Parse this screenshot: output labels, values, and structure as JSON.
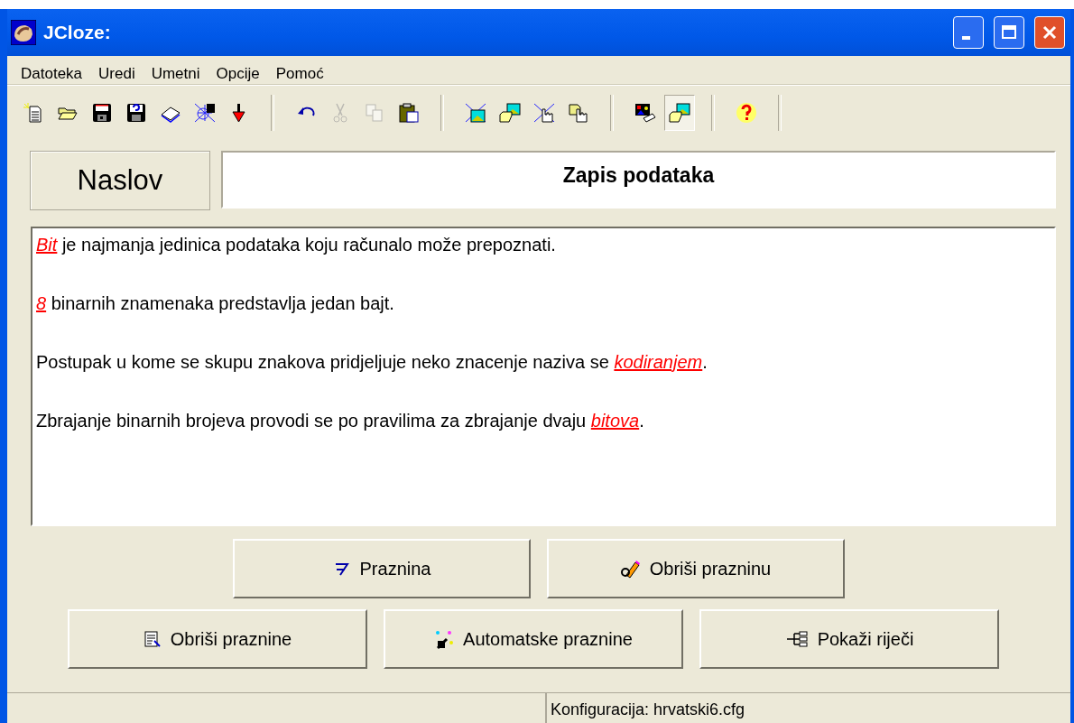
{
  "window": {
    "title": "JCloze:"
  },
  "menu": [
    "Datoteka",
    "Uredi",
    "Umetni",
    "Opcije",
    "Pomoć"
  ],
  "toolbar": [
    {
      "kind": "new",
      "disabled": false,
      "pressed": false
    },
    {
      "kind": "open",
      "disabled": false,
      "pressed": false
    },
    {
      "kind": "save",
      "disabled": false,
      "pressed": false
    },
    {
      "kind": "saveas",
      "disabled": false,
      "pressed": false
    },
    {
      "kind": "book",
      "disabled": false,
      "pressed": false
    },
    {
      "kind": "web6",
      "disabled": false,
      "pressed": false
    },
    {
      "kind": "arrow",
      "disabled": false,
      "pressed": false
    },
    {
      "kind": "separator"
    },
    {
      "kind": "undo",
      "disabled": false,
      "pressed": false
    },
    {
      "kind": "cut",
      "disabled": true,
      "pressed": false
    },
    {
      "kind": "copy",
      "disabled": true,
      "pressed": false
    },
    {
      "kind": "paste",
      "disabled": false,
      "pressed": false
    },
    {
      "kind": "separator"
    },
    {
      "kind": "webpic",
      "disabled": false,
      "pressed": false
    },
    {
      "kind": "folderpic",
      "disabled": false,
      "pressed": false
    },
    {
      "kind": "webhand",
      "disabled": false,
      "pressed": false
    },
    {
      "kind": "folderhand",
      "disabled": false,
      "pressed": false
    },
    {
      "kind": "separator"
    },
    {
      "kind": "pictag",
      "disabled": false,
      "pressed": false
    },
    {
      "kind": "folderpic",
      "disabled": false,
      "pressed": true
    },
    {
      "kind": "separator"
    },
    {
      "kind": "help",
      "disabled": false,
      "pressed": false
    },
    {
      "kind": "separator"
    }
  ],
  "title_row": {
    "label": "Naslov",
    "value": "Zapis podataka"
  },
  "text": [
    "*Bit* je najmanja  jedinica podataka koju računalo može prepoznati.",
    "*8* binarnih znamenaka predstavlja jedan bajt.",
    "Postupak u kome se skupu znakova pridjeljuje neko znacenje naziva se *kodiranjem*.",
    "Zbrajanje binarnih brojeva provodi se po pravilima za zbrajanje dvaju *bitova*."
  ],
  "button_rows": [
    [
      {
        "label": "Praznina",
        "kind": "gap"
      },
      {
        "label": "Obriši prazninu",
        "kind": "eraser"
      }
    ],
    [
      {
        "label": "Obriši praznine",
        "kind": "list"
      },
      {
        "label": "Automatske praznine",
        "kind": "wand"
      },
      {
        "label": "Pokaži riječi",
        "kind": "tree"
      }
    ]
  ],
  "status_bar": {
    "config": "Konfiguracija: hrvatski6.cfg"
  }
}
